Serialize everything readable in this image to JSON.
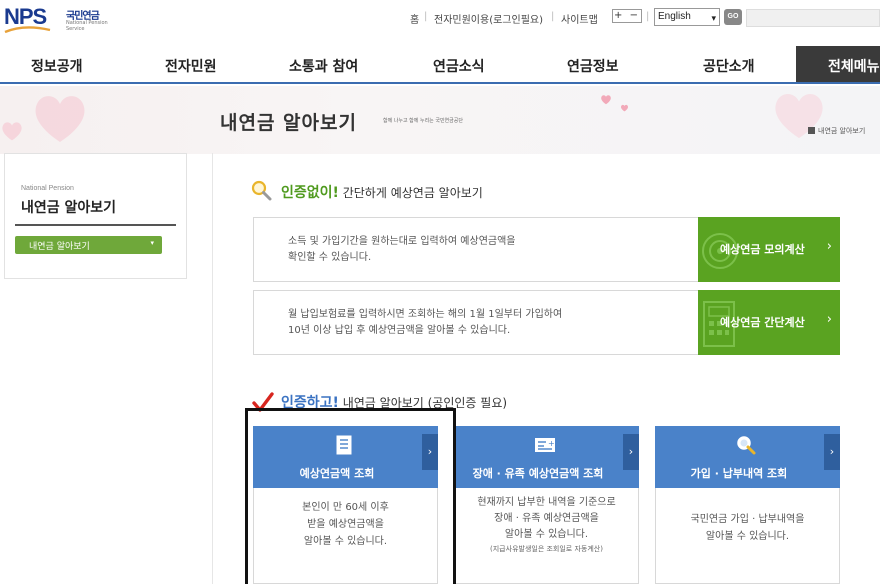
{
  "header": {
    "logo_mark": "NPS",
    "logo_korean": "국민연금",
    "logo_english": "National Pension Service",
    "util_links": [
      "홈",
      "전자민원이용(로그인필요)",
      "사이트맵"
    ],
    "font_size_controls": "+ −",
    "language_selected": "English",
    "go_label": "GO"
  },
  "gnb": {
    "items": [
      "정보공개",
      "전자민원",
      "소통과 참여",
      "연금소식",
      "연금정보",
      "공단소개"
    ],
    "all_menu": "전체메뉴"
  },
  "banner": {
    "title": "내연금 알아보기",
    "slogan": "함께 나누고 함께 누리는 국민연금공단",
    "breadcrumb": "내연금 알아보기"
  },
  "sidebar": {
    "english_label": "National Pension",
    "title": "내연금 알아보기",
    "menu_button": "내연금 알아보기",
    "menu_arrow": "▾"
  },
  "section_no_auth": {
    "emphasis": "인증없이!",
    "rest": " 간단하게 예상연금 알아보기"
  },
  "estimate_boxes": [
    {
      "desc_line1": "소득 및 가입기간을 원하는대로 입력하여 예상연금액을",
      "desc_line2": "확인할 수 있습니다.",
      "cta": "예상연금 모의계산"
    },
    {
      "desc_line1": "월 납입보험료를 입력하시면 조회하는 해의 1월 1일부터 가입하여",
      "desc_line2": "10년 이상 납입 후 예상연금액을 알아볼 수 있습니다.",
      "cta": "예상연금 간단계산"
    }
  ],
  "section_auth": {
    "emphasis": "인증하고!",
    "rest": " 내연금 알아보기 (공인인증 필요)"
  },
  "cards": [
    {
      "title": "예상연금액 조회",
      "line1": "본인이 만 60세 이후",
      "line2": "받을 예상연금액을",
      "line3": "알아볼 수 있습니다.",
      "note": ""
    },
    {
      "title": "장애 · 유족 예상연금액 조회",
      "line1": "현재까지 납부한 내역을 기준으로",
      "line2": "장애 · 유족 예상연금액을",
      "line3": "알아볼 수 있습니다.",
      "note": "(지급사유발생일은 조회일로 자동계산)"
    },
    {
      "title": "가입 · 납부내역 조회",
      "line1": "국민연금 가입 · 납부내역을",
      "line2": "알아볼 수 있습니다.",
      "line3": "",
      "note": ""
    }
  ],
  "colors": {
    "nav_accent": "#3b6cb0",
    "green_cta": "#5aa321",
    "sidebar_green": "#6fa83a",
    "card_blue": "#4a82c9",
    "checkmark_red": "#d7261f",
    "magnifier_yellow": "#e9b52b"
  }
}
